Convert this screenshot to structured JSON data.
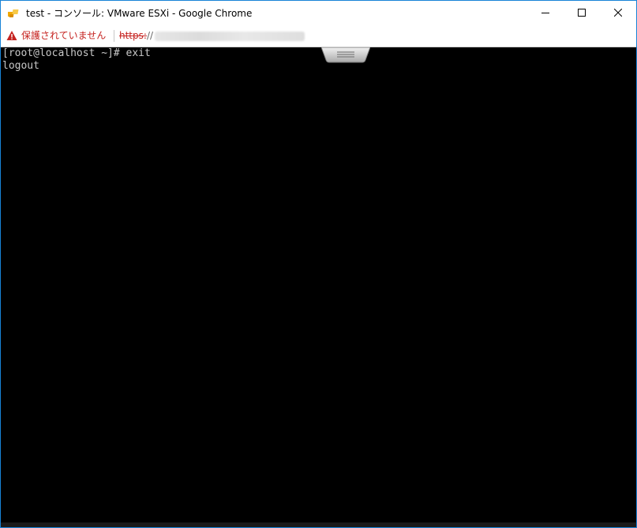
{
  "window": {
    "title": "test - コンソール: VMware ESXi - Google Chrome",
    "controls": {
      "minimize_icon": "minimize-icon",
      "maximize_icon": "maximize-icon",
      "close_icon": "close-icon"
    }
  },
  "addressbar": {
    "security_icon": "warning-triangle-icon",
    "security_label": "保護されていません",
    "url_scheme": "https:",
    "url_slash": "//",
    "url_host_blurred": true
  },
  "console": {
    "lines": [
      "[root@localhost ~]# exit",
      "logout"
    ],
    "text_color": "#c8c8c8",
    "background": "#000000"
  },
  "colors": {
    "window_border": "#1883d7",
    "warning": "#c5221f"
  }
}
